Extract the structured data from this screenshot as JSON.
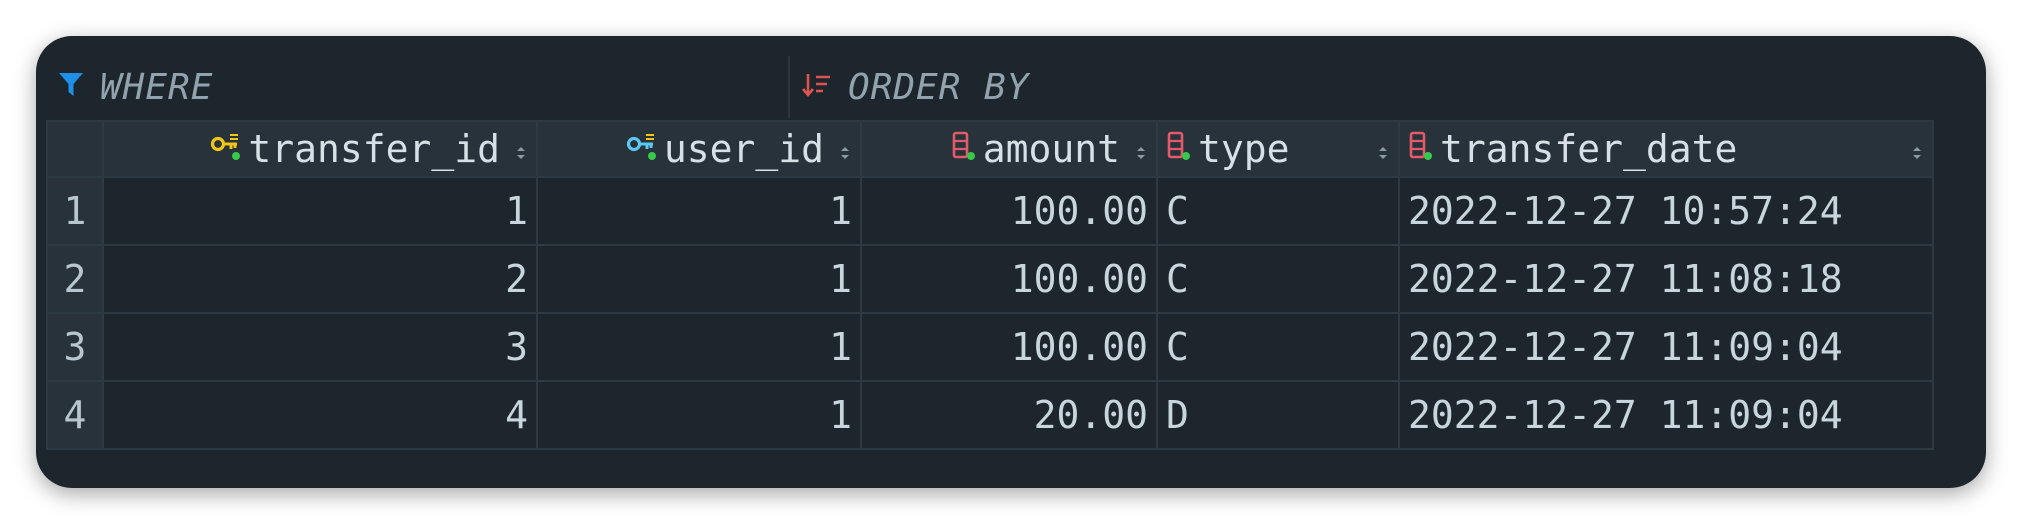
{
  "filter_bar": {
    "where_label": "WHERE",
    "order_by_label": "ORDER BY"
  },
  "table": {
    "columns": [
      {
        "name": "transfer_id",
        "icon": "primary-key-icon",
        "align": "right"
      },
      {
        "name": "user_id",
        "icon": "foreign-key-icon",
        "align": "right"
      },
      {
        "name": "amount",
        "icon": "column-icon",
        "align": "right"
      },
      {
        "name": "type",
        "icon": "column-icon",
        "align": "left"
      },
      {
        "name": "transfer_date",
        "icon": "column-icon",
        "align": "left"
      }
    ],
    "rows": [
      {
        "num": "1",
        "cells": [
          "1",
          "1",
          "100.00",
          "C",
          "2022-12-27 10:57:24"
        ]
      },
      {
        "num": "2",
        "cells": [
          "2",
          "1",
          "100.00",
          "C",
          "2022-12-27 11:08:18"
        ]
      },
      {
        "num": "3",
        "cells": [
          "3",
          "1",
          "100.00",
          "C",
          "2022-12-27 11:09:04"
        ]
      },
      {
        "num": "4",
        "cells": [
          "4",
          "1",
          "20.00",
          "D",
          "2022-12-27 11:09:04"
        ]
      }
    ]
  },
  "colors": {
    "filter_icon": "#1e90e8",
    "order_icon": "#e0524f",
    "primary_key": "#f2c517",
    "foreign_key": "#5cc8f2",
    "column_icon": "#e35a6a",
    "not_null_dot": "#37c94a"
  }
}
